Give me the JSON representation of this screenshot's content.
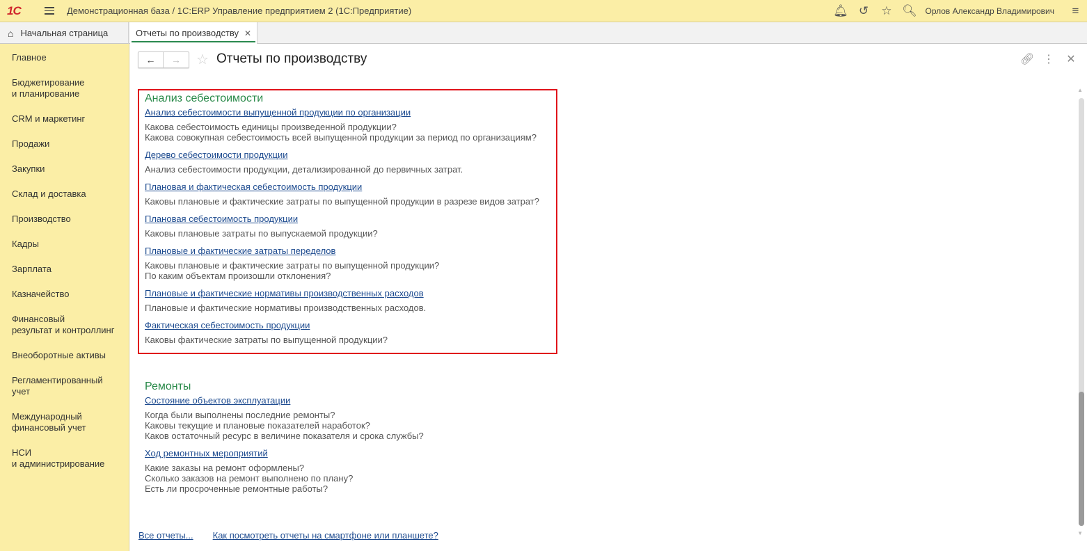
{
  "app": {
    "logo": "1С",
    "title": "Демонстрационная база / 1С:ERP Управление предприятием 2  (1С:Предприятие)",
    "user": "Орлов Александр Владимирович"
  },
  "tabs": {
    "home": "Начальная страница",
    "current": "Отчеты по производству"
  },
  "sidebar": {
    "items": [
      "Главное",
      "Бюджетирование\nи планирование",
      "CRM и маркетинг",
      "Продажи",
      "Закупки",
      "Склад и доставка",
      "Производство",
      "Кадры",
      "Зарплата",
      "Казначейство",
      "Финансовый\nрезультат и контроллинг",
      "Внеоборотные активы",
      "Регламентированный\nучет",
      "Международный\nфинансовый учет",
      "НСИ\nи администрирование"
    ]
  },
  "page": {
    "title": "Отчеты по производству"
  },
  "sections": [
    {
      "title": "Анализ себестоимости",
      "reports": [
        {
          "link": "Анализ себестоимости выпущенной продукции по организации",
          "desc": [
            "Какова себестоимость единицы произведенной продукции?",
            "Какова совокупная себестоимость всей выпущенной продукции за период по организациям?"
          ]
        },
        {
          "link": "Дерево себестоимости продукции",
          "desc": [
            "Анализ себестоимости продукции, детализированной до первичных затрат."
          ]
        },
        {
          "link": "Плановая и фактическая себестоимость продукции",
          "desc": [
            "Каковы плановые и фактические затраты по выпущенной продукции в разрезе видов затрат?"
          ]
        },
        {
          "link": "Плановая себестоимость продукции",
          "desc": [
            "Каковы плановые затраты по выпускаемой продукции?"
          ]
        },
        {
          "link": "Плановые и фактические затраты переделов",
          "desc": [
            "Каковы плановые и фактические затраты по выпущенной продукции?",
            "По каким объектам произошли отклонения?"
          ]
        },
        {
          "link": "Плановые и фактические нормативы производственных расходов",
          "desc": [
            "Плановые и фактические нормативы производственных расходов."
          ]
        },
        {
          "link": "Фактическая себестоимость продукции",
          "desc": [
            "Каковы фактические затраты по выпущенной продукции?"
          ]
        }
      ]
    },
    {
      "title": "Ремонты",
      "reports": [
        {
          "link": "Состояние объектов эксплуатации",
          "desc": [
            "Когда были выполнены последние ремонты?",
            "Каковы текущие и плановые показателей наработок?",
            "Каков остаточный ресурс в величине показателя и срока службы?"
          ]
        },
        {
          "link": "Ход ремонтных мероприятий",
          "desc": [
            "Какие заказы на ремонт оформлены?",
            "Сколько заказов на ремонт выполнено по плану?",
            "Есть ли просроченные ремонтные работы?"
          ]
        }
      ]
    }
  ],
  "footer": {
    "all_reports": "Все отчеты...",
    "mobile": "Как посмотреть отчеты на смартфоне или планшете?"
  }
}
